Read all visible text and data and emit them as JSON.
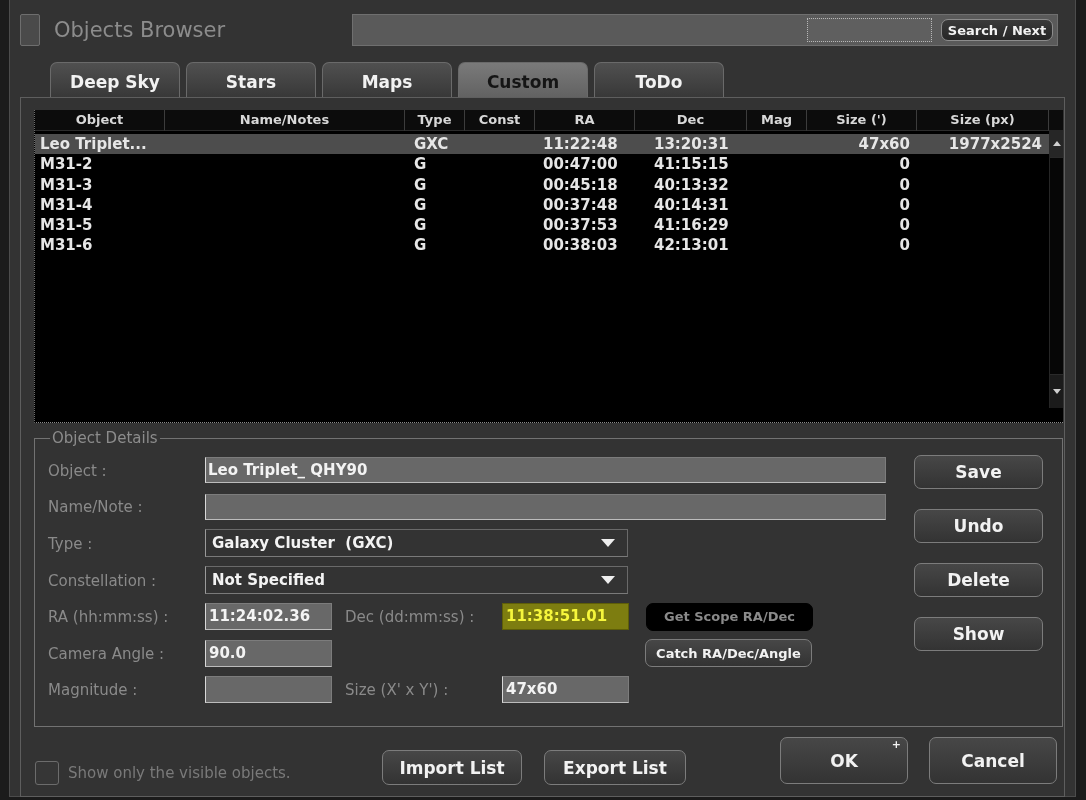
{
  "window": {
    "title": "Objects Browser"
  },
  "search": {
    "button": "Search / Next"
  },
  "tabs": [
    {
      "label": "Deep Sky",
      "selected": false
    },
    {
      "label": "Stars",
      "selected": false
    },
    {
      "label": "Maps",
      "selected": false
    },
    {
      "label": "Custom",
      "selected": true
    },
    {
      "label": "ToDo",
      "selected": false
    }
  ],
  "table": {
    "columns": [
      "Object",
      "Name/Notes",
      "Type",
      "Const",
      "RA",
      "Dec",
      "Mag",
      "Size (')",
      "Size (px)"
    ],
    "rows": [
      {
        "selected": true,
        "cells": [
          "Leo Triplet...",
          null,
          "GXC",
          null,
          "11:22:48",
          "13:20:31",
          null,
          "47x60",
          "1977x2524"
        ]
      },
      {
        "selected": false,
        "cells": [
          "M31-2",
          null,
          "G",
          null,
          "00:47:00",
          "41:15:15",
          null,
          "0",
          null
        ]
      },
      {
        "selected": false,
        "cells": [
          "M31-3",
          null,
          "G",
          null,
          "00:45:18",
          "40:13:32",
          null,
          "0",
          null
        ]
      },
      {
        "selected": false,
        "cells": [
          "M31-4",
          null,
          "G",
          null,
          "00:37:48",
          "40:14:31",
          null,
          "0",
          null
        ]
      },
      {
        "selected": false,
        "cells": [
          "M31-5",
          null,
          "G",
          null,
          "00:37:53",
          "41:16:29",
          null,
          "0",
          null
        ]
      },
      {
        "selected": false,
        "cells": [
          "M31-6",
          null,
          "G",
          null,
          "00:38:03",
          "42:13:01",
          null,
          "0",
          null
        ]
      }
    ]
  },
  "object_details": {
    "title": "Object Details",
    "rows": [
      {
        "items": [
          {
            "label": "Object :",
            "kind": "text",
            "value": "Leo Triplet_ QHY90",
            "highlighted": false
          }
        ]
      },
      {
        "items": [
          {
            "label": "Name/Note :",
            "kind": "text",
            "highlighted": false
          }
        ]
      },
      {
        "items": [
          {
            "label": "Type :",
            "kind": "select",
            "value": "Galaxy Cluster  (GXC)",
            "highlighted": false
          }
        ]
      },
      {
        "items": [
          {
            "label": "Constellation :",
            "kind": "select",
            "value": "Not Specified",
            "highlighted": false
          }
        ]
      },
      {
        "items": [
          {
            "label": "RA (hh:mm:ss) :",
            "kind": "short",
            "value": "11:24:02.36",
            "highlighted": false
          },
          {
            "label": "Dec (dd:mm:ss) :",
            "kind": "short",
            "value": "11:38:51.01",
            "highlighted": true
          }
        ],
        "button": {
          "label": "Get Scope RA/Dec",
          "disabled": true
        }
      },
      {
        "items": [
          {
            "label": "Camera Angle :",
            "kind": "short",
            "value": "90.0",
            "highlighted": false
          }
        ],
        "button": {
          "label": "Catch RA/Dec/Angle",
          "disabled": false
        }
      },
      {
        "items": [
          {
            "label": "Magnitude :",
            "kind": "short",
            "highlighted": false
          },
          {
            "label": "Size (X' x Y') :",
            "kind": "short",
            "value": "47x60",
            "highlighted": false
          }
        ]
      }
    ],
    "action_buttons": [
      "Save",
      "Undo",
      "Delete",
      "Show"
    ]
  },
  "footer": {
    "checkbox": {
      "label": "Show only the visible objects.",
      "checked": false
    },
    "list_buttons": [
      "Import List",
      "Export List"
    ],
    "dialog_buttons": [
      {
        "label": "OK",
        "badge": "+"
      },
      {
        "label": "Cancel"
      }
    ]
  }
}
